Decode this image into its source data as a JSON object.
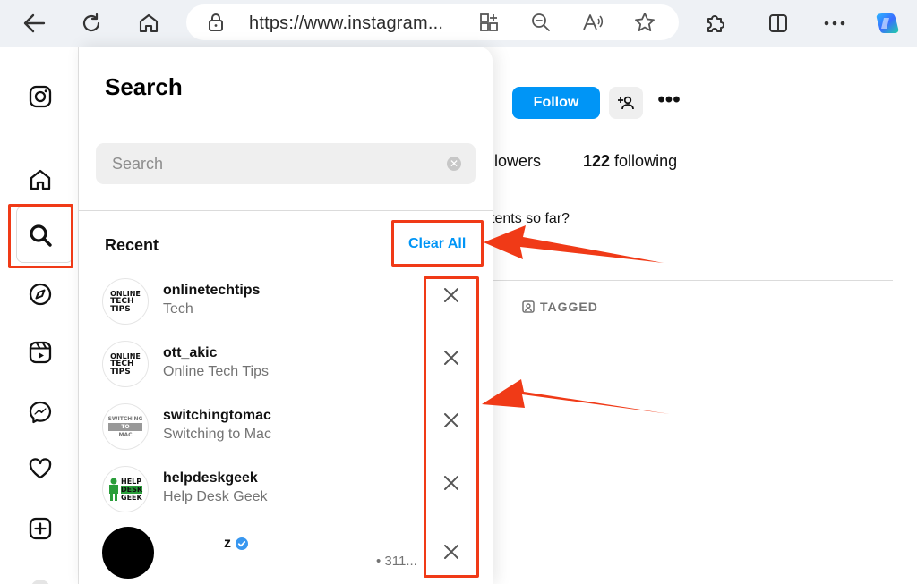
{
  "browser": {
    "url": "https://www.instagram...",
    "nav": [
      "back-icon",
      "refresh-icon",
      "home-icon"
    ],
    "url_actions": [
      "apps-icon",
      "zoom-out-icon",
      "read-aloud-icon",
      "favorite-icon"
    ],
    "toolbar_right": [
      "extensions-icon",
      "split-screen-icon",
      "more-icon",
      "copilot-icon"
    ]
  },
  "sidebar": {
    "items": [
      "instagram-logo-icon",
      "home-icon",
      "search-icon",
      "explore-icon",
      "reels-icon",
      "messenger-icon",
      "notifications-icon",
      "create-icon"
    ]
  },
  "search_panel": {
    "title": "Search",
    "input_placeholder": "Search",
    "recent_label": "Recent",
    "clear_all_label": "Clear All",
    "items": [
      {
        "username": "onlinetechtips",
        "subtitle": "Tech",
        "logo": [
          "ONLINE",
          "TECH",
          "TIPS"
        ]
      },
      {
        "username": "ott_akic",
        "subtitle": "Online Tech Tips",
        "logo": [
          "ONLINE",
          "TECH",
          "TIPS"
        ]
      },
      {
        "username": "switchingtomac",
        "subtitle": "Switching to Mac",
        "logo": [
          "SWITCHING",
          "TO",
          "MAC"
        ]
      },
      {
        "username": "helpdeskgeek",
        "subtitle": "Help Desk Geek",
        "logo": [
          "HELP",
          "DESK",
          "GEEK"
        ]
      },
      {
        "username": "z",
        "subtitle": "• 311...",
        "verified": true
      }
    ]
  },
  "profile": {
    "follow_label": "Follow",
    "followers_partial": "llowers",
    "following_count": "122",
    "following_label": " following",
    "bio_partial": "tents so far?",
    "tagged_label": "TAGGED"
  },
  "colors": {
    "accent": "#0095f6",
    "annotation": "#f03a17"
  }
}
